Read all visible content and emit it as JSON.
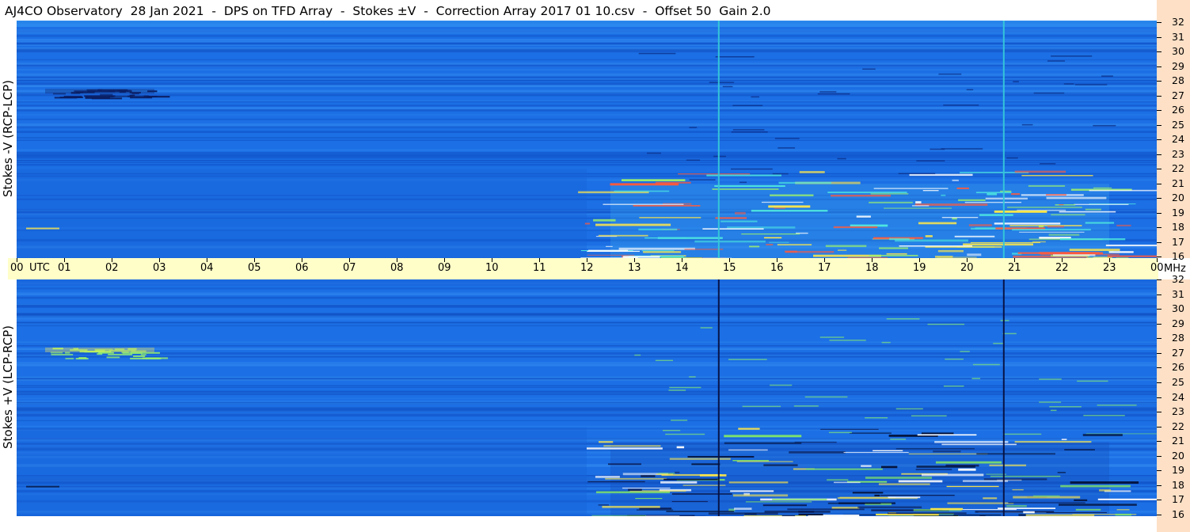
{
  "title": "AJ4CO Observatory  28 Jan 2021  -  DPS on TFD Array  -  Stokes ±V  -  Correction Array 2017 01 10.csv  -  Offset 50  Gain 2.0",
  "chart_data": [
    {
      "type": "heatmap",
      "ylabel": "Stokes -V (RCP-LCP)",
      "x_unit": "UTC",
      "y_unit": "MHz",
      "xlim": [
        0,
        24
      ],
      "ylim": [
        16,
        32
      ],
      "x_ticks": [
        "00",
        "01",
        "02",
        "03",
        "04",
        "05",
        "06",
        "07",
        "08",
        "09",
        "10",
        "11",
        "12",
        "13",
        "14",
        "15",
        "16",
        "17",
        "18",
        "19",
        "20",
        "21",
        "22",
        "23",
        "00"
      ],
      "y_ticks": [
        16,
        17,
        18,
        19,
        20,
        21,
        22,
        23,
        24,
        25,
        26,
        27,
        28,
        29,
        30,
        31,
        32
      ],
      "vertical_lines_utc": [
        14.78,
        20.78
      ],
      "vertical_line_color": "#35c8d8"
    },
    {
      "type": "heatmap",
      "ylabel": "Stokes +V (LCP-RCP)",
      "x_unit": "UTC",
      "y_unit": "MHz",
      "xlim": [
        0,
        24
      ],
      "ylim": [
        16,
        32
      ],
      "x_ticks": [
        "00",
        "01",
        "02",
        "03",
        "04",
        "05",
        "06",
        "07",
        "08",
        "09",
        "10",
        "11",
        "12",
        "13",
        "14",
        "15",
        "16",
        "17",
        "18",
        "19",
        "20",
        "21",
        "22",
        "23",
        "00"
      ],
      "y_ticks": [
        16,
        17,
        18,
        19,
        20,
        21,
        22,
        23,
        24,
        25,
        26,
        27,
        28,
        29,
        30,
        31,
        32
      ],
      "vertical_lines_utc": [
        14.78,
        20.78
      ],
      "vertical_line_color": "#061040"
    }
  ],
  "axis": {
    "time_label_unit": "UTC",
    "freq_label_unit": "MHz"
  },
  "colors": {
    "background_blue": "#1e73e6",
    "axis_strip": "#fffec8",
    "freq_strip": "#fde0c6"
  }
}
